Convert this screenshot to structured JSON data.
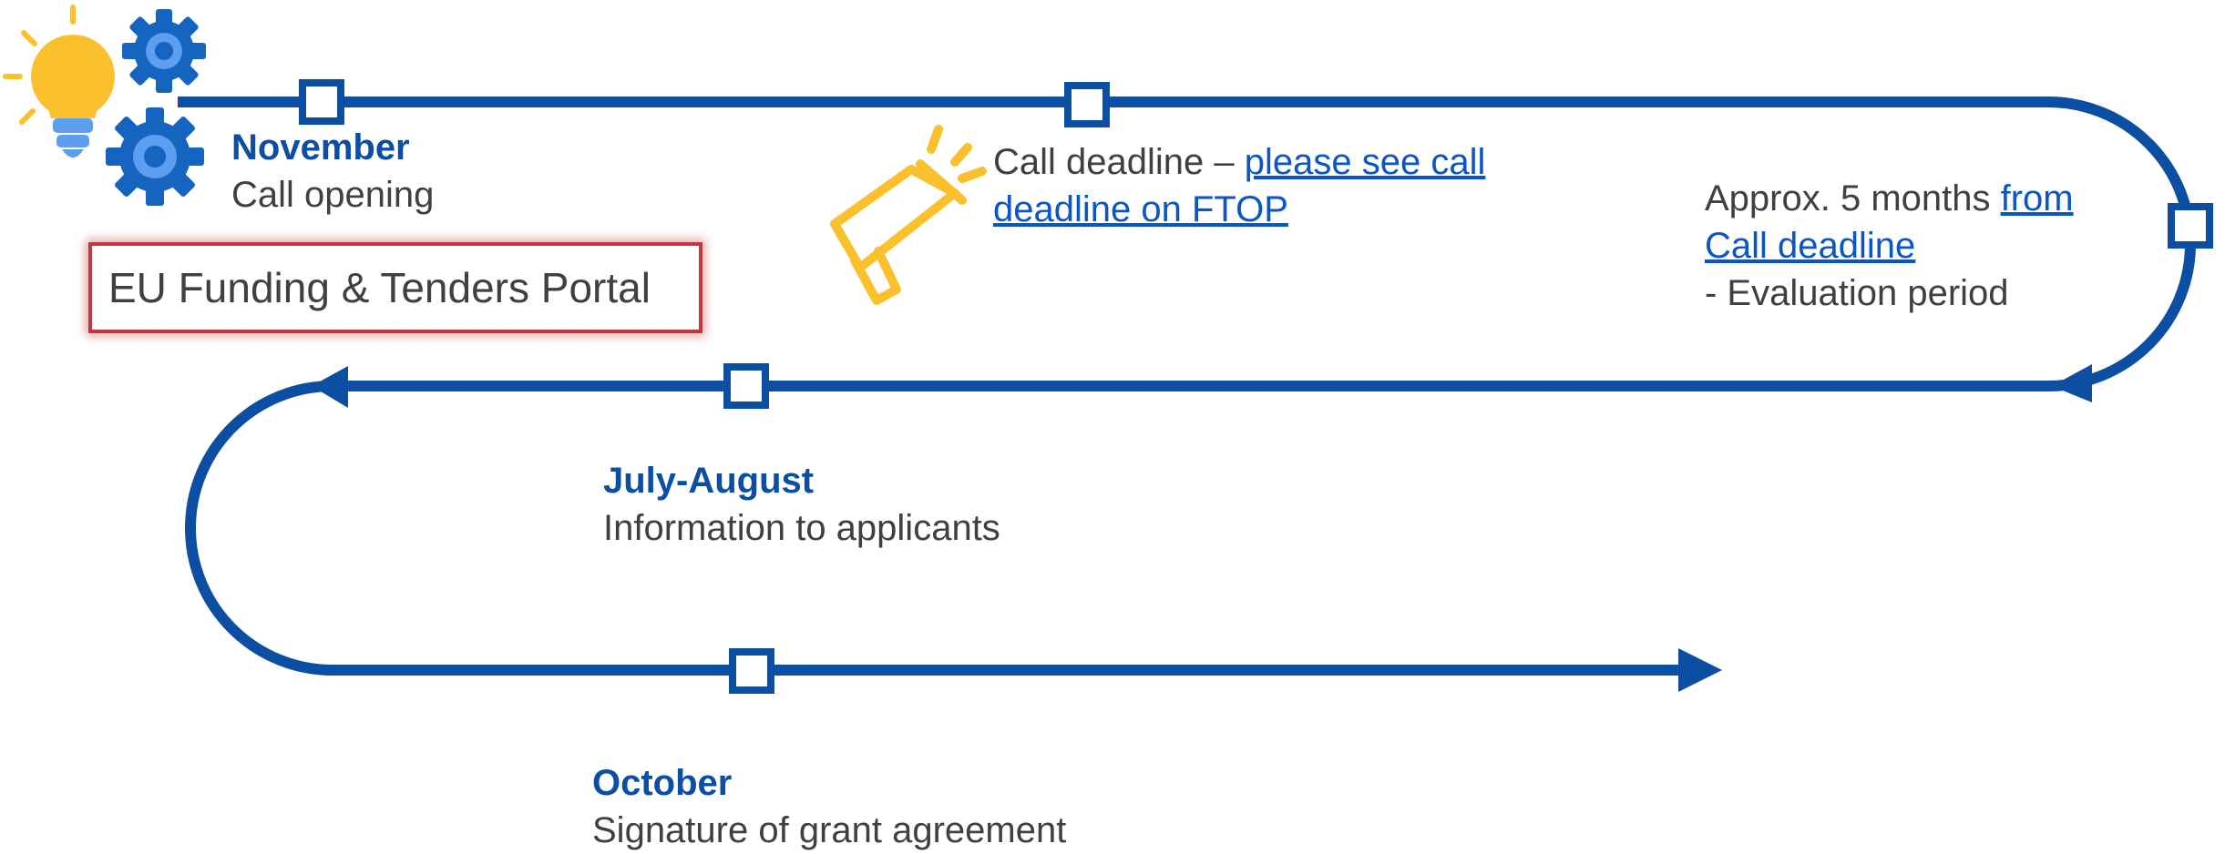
{
  "portal": {
    "label": "EU Funding & Tenders Portal"
  },
  "stages": {
    "november": {
      "month": "November",
      "desc": "Call opening"
    },
    "deadline": {
      "prefix": "Call deadline – ",
      "link_line1": "please see call",
      "link_line2": "deadline on FTOP"
    },
    "evaluation": {
      "prefix": "Approx. 5 months ",
      "link_line1": "from",
      "link_line2": "Call deadline",
      "suffix": "- Evaluation period"
    },
    "july_august": {
      "month": "July-August",
      "desc": "Information to applicants"
    },
    "october": {
      "month": "October",
      "desc": "Signature of grant agreement"
    }
  },
  "colors": {
    "path": "#0b4ea2",
    "month_text": "#0b4ea2",
    "body_text": "#404040",
    "link": "#0b56c4",
    "portal_border": "#c0373f",
    "bulb": "#fbc02d",
    "gear": "#1565c0",
    "megaphone": "#fbc02d"
  },
  "icons": {
    "idea": "lightbulb-gears-icon",
    "announcement": "megaphone-icon"
  }
}
